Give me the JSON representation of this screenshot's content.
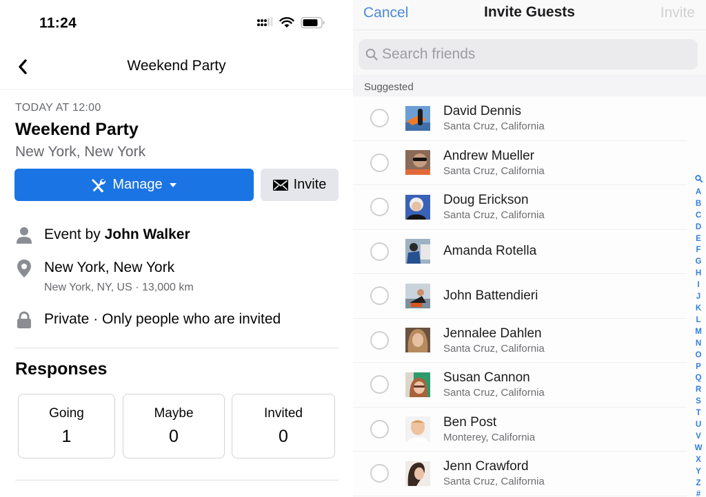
{
  "status_bar": {
    "time": "11:24",
    "icons": [
      "cellular-signal-icon",
      "wifi-icon",
      "battery-icon"
    ]
  },
  "event_page": {
    "nav_title": "Weekend Party",
    "back_icon": "chevron-left-icon",
    "date": "TODAY AT 12:00",
    "title": "Weekend Party",
    "location": "New York, New York",
    "manage_button": {
      "label": "Manage",
      "icon": "tools-icon",
      "caret": "caret-down-icon"
    },
    "invite_button": {
      "label": "Invite",
      "icon": "envelope-icon"
    },
    "details": {
      "host_prefix": "Event by",
      "host_name": "John Walker",
      "place_name": "New York, New York",
      "place_sub": "New York, NY, US · 13,000 km",
      "privacy": "Private · Only people who are invited"
    },
    "responses": {
      "title": "Responses",
      "items": [
        {
          "label": "Going",
          "count": "1"
        },
        {
          "label": "Maybe",
          "count": "0"
        },
        {
          "label": "Invited",
          "count": "0"
        }
      ]
    }
  },
  "invite_sheet": {
    "cancel_label": "Cancel",
    "title": "Invite Guests",
    "invite_label": "Invite",
    "search": {
      "placeholder": "Search friends",
      "value": ""
    },
    "section_label": "Suggested",
    "friends": [
      {
        "name": "David Dennis",
        "location": "Santa Cruz, California"
      },
      {
        "name": "Andrew Mueller",
        "location": "Santa Cruz, California"
      },
      {
        "name": "Doug Erickson",
        "location": "Santa Cruz, California"
      },
      {
        "name": "Amanda Rotella",
        "location": ""
      },
      {
        "name": "John Battendieri",
        "location": ""
      },
      {
        "name": "Jennalee Dahlen",
        "location": "Santa Cruz, California"
      },
      {
        "name": "Susan Cannon",
        "location": "Santa Cruz, California"
      },
      {
        "name": "Ben Post",
        "location": "Monterey, California"
      },
      {
        "name": "Jenn Crawford",
        "location": "Santa Cruz, California"
      }
    ],
    "index_letters": [
      "A",
      "B",
      "C",
      "D",
      "E",
      "F",
      "G",
      "H",
      "I",
      "J",
      "K",
      "L",
      "M",
      "N",
      "O",
      "P",
      "Q",
      "R",
      "S",
      "T",
      "U",
      "V",
      "W",
      "X",
      "Y",
      "Z",
      "#"
    ]
  },
  "colors": {
    "primary_blue": "#1b74e4",
    "secondary_button": "#e4e6eb",
    "ios_link_blue": "#4a8ad8",
    "disabled_text": "#d0d0d2",
    "index_blue": "#2f7ee0"
  }
}
